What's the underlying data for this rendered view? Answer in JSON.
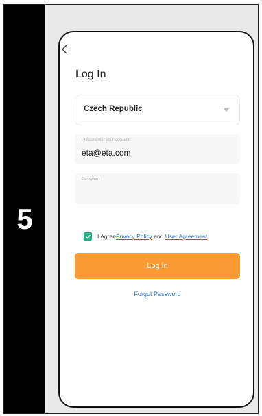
{
  "step": "5",
  "login": {
    "title": "Log In",
    "country": "Czech Republic",
    "account_label": "Please enter your account",
    "account_value": "eta@eta.com",
    "password_label": "Password",
    "password_value": "",
    "agree_prefix": "I Agree",
    "privacy_link": "Privacy Policy",
    "agree_and": " and ",
    "agreement_link": "User Agreement",
    "login_button": "Log In",
    "forgot_password": "Forgot Password"
  },
  "colors": {
    "accent": "#fa9c33",
    "checkbox": "#20b17d",
    "link": "#2f6fd6"
  },
  "icons": {
    "back": "back-icon",
    "dropdown": "dropdown-icon",
    "check": "check-icon"
  }
}
